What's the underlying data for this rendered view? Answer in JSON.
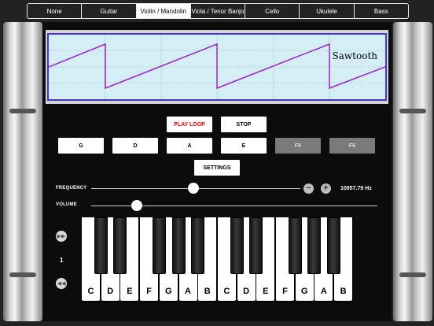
{
  "tabs": [
    "None",
    "Guitar",
    "Violin / Mandolin",
    "Viola / Tenor Banjo",
    "Cello",
    "Ukulele",
    "Bass"
  ],
  "active_tab": "Violin / Mandolin",
  "scope": {
    "waveform_label": "Sawtooth"
  },
  "controls": {
    "play_loop": "PLAY LOOP",
    "stop": "STOP",
    "settings": "SETTINGS"
  },
  "strings": [
    "G",
    "D",
    "A",
    "E",
    "F5",
    "F6"
  ],
  "frequency": {
    "label": "FREQUENCY",
    "value_text": "10957.79 Hz",
    "slider_fraction": 0.49,
    "minus_icon": "minus-icon",
    "plus_icon": "plus-icon"
  },
  "volume": {
    "label": "VOLUME",
    "slider_fraction": 0.16
  },
  "octave": {
    "value": "1",
    "up_icon": "fast-forward-icon",
    "down_icon": "rewind-icon"
  },
  "keyboard": {
    "white_keys": [
      "C",
      "D",
      "E",
      "F",
      "G",
      "A",
      "B",
      "C",
      "D",
      "E",
      "F",
      "G",
      "A",
      "B"
    ]
  },
  "colors": {
    "play_loop_text": "#e00000",
    "wave": "#a020c8",
    "scope_bg": "#d4eef6",
    "scope_border": "#4b38b8"
  }
}
